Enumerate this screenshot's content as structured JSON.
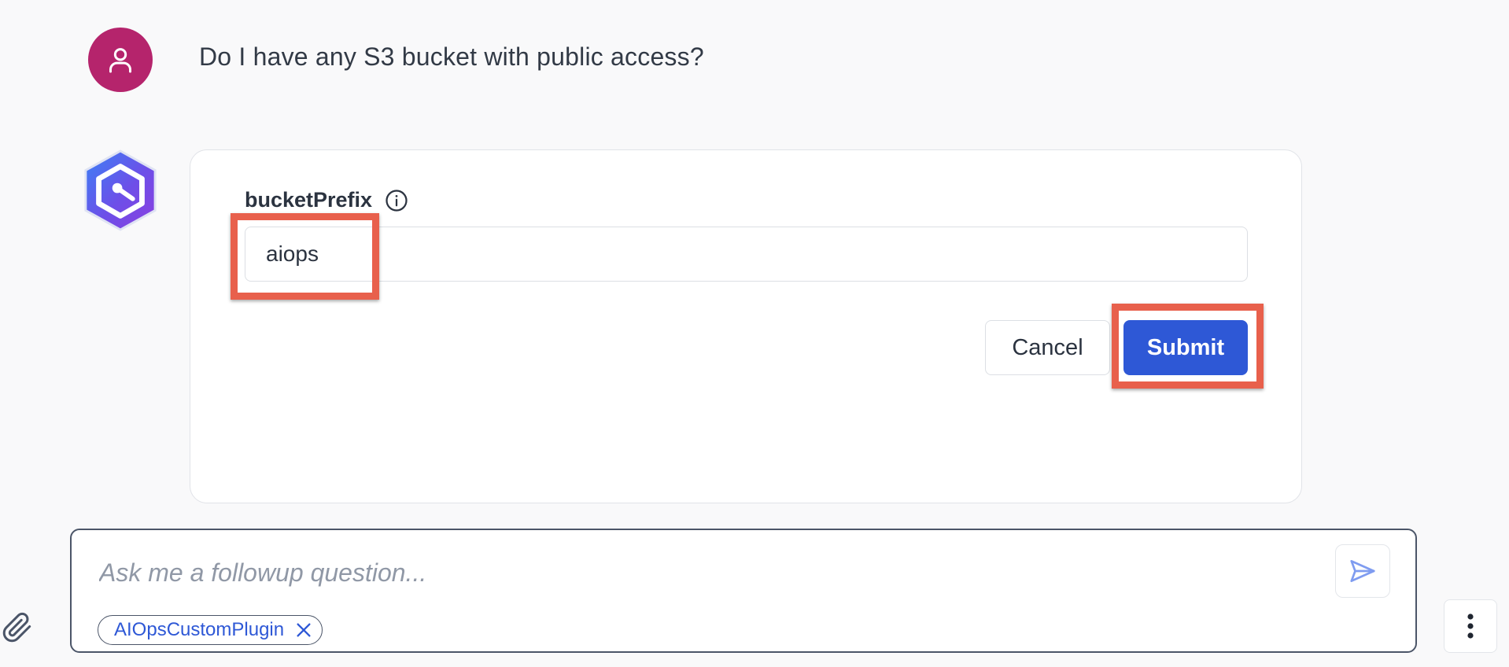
{
  "conversation": {
    "user_message": "Do I have any S3 bucket with public access?",
    "user_avatar_icon": "user-icon",
    "bot_avatar_icon": "hexagon-logo-icon"
  },
  "form": {
    "field_label": "bucketPrefix",
    "field_info_icon": "info-icon",
    "field_value": "aiops",
    "cancel_label": "Cancel",
    "submit_label": "Submit"
  },
  "composer": {
    "placeholder": "Ask me a followup question...",
    "plugin_chip_label": "AIOpsCustomPlugin",
    "send_icon": "send-icon",
    "attach_icon": "paperclip-icon",
    "more_icon": "more-vertical-icon"
  },
  "colors": {
    "primary": "#2e58d6",
    "avatar": "#b5246c",
    "highlight": "#e8604c",
    "background": "#f9f9fa"
  }
}
